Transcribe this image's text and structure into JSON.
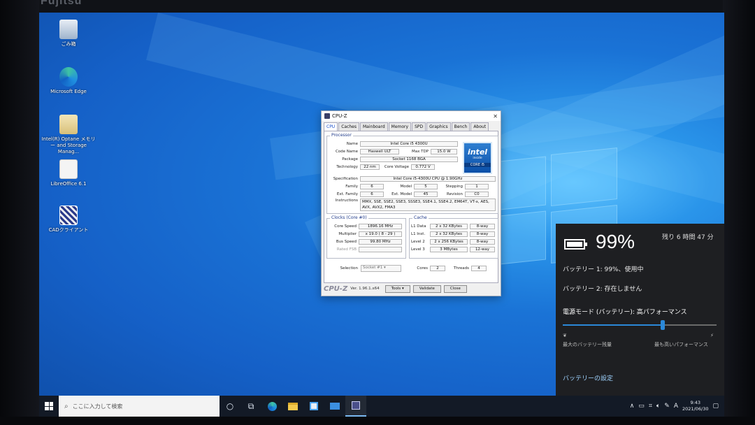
{
  "bezel": {
    "brand": "Fujitsu"
  },
  "desktop": {
    "icons": [
      {
        "label": "ごみ箱",
        "icon": "recycle-bin-icon"
      },
      {
        "label": "Microsoft Edge",
        "icon": "edge-icon"
      },
      {
        "label": "Intel(R) Optane メモリー and Storage Manag...",
        "icon": "folder-icon"
      },
      {
        "label": "LibreOffice 6.1",
        "icon": "document-icon"
      },
      {
        "label": "CADクライアント",
        "icon": "app-icon"
      }
    ]
  },
  "cpuz": {
    "title": "CPU-Z",
    "tabs": [
      "CPU",
      "Caches",
      "Mainboard",
      "Memory",
      "SPD",
      "Graphics",
      "Bench",
      "About"
    ],
    "processor": {
      "group_title": "Processor",
      "name_label": "Name",
      "name": "Intel Core i5 4300U",
      "codename_label": "Code Name",
      "codename": "Haswell ULT",
      "maxtdp_label": "Max TDP",
      "maxtdp": "15.0 W",
      "package_label": "Package",
      "package": "Socket 1168 BGA",
      "technology_label": "Technology",
      "technology": "22 nm",
      "voltage_label": "Core Voltage",
      "voltage": "0.772 V",
      "spec_label": "Specification",
      "spec": "Intel Core i5-4300U CPU @ 1.90GHz",
      "family_label": "Family",
      "family": "6",
      "model_label": "Model",
      "model": "5",
      "stepping_label": "Stepping",
      "stepping": "1",
      "extfamily_label": "Ext. Family",
      "extfamily": "6",
      "extmodel_label": "Ext. Model",
      "extmodel": "45",
      "revision_label": "Revision",
      "revision": "C0",
      "instructions_label": "Instructions",
      "instructions": "MMX, SSE, SSE2, SSE3, SSSE3, SSE4.1, SSE4.2, EM64T, VT-x, AES, AVX, AVX2, FMA3"
    },
    "intel_badge": {
      "brand": "intel",
      "inside": "inside",
      "line": "CORE i5"
    },
    "clocks": {
      "group_title": "Clocks (Core #0)",
      "corespeed_label": "Core Speed",
      "corespeed": "1896.16 MHz",
      "multiplier_label": "Multiplier",
      "multiplier": "x 19.0 ( 8 - 29 )",
      "busspeed_label": "Bus Speed",
      "busspeed": "99.80 MHz",
      "ratedfsb_label": "Rated FSB",
      "ratedfsb": ""
    },
    "cache": {
      "group_title": "Cache",
      "rows": [
        {
          "label": "L1 Data",
          "size": "2 x 32 KBytes",
          "way": "8-way"
        },
        {
          "label": "L1 Inst.",
          "size": "2 x 32 KBytes",
          "way": "8-way"
        },
        {
          "label": "Level 2",
          "size": "2 x 256 KBytes",
          "way": "8-way"
        },
        {
          "label": "Level 3",
          "size": "3 MBytes",
          "way": "12-way"
        }
      ]
    },
    "selection_label": "Selection",
    "selection": "Socket #1",
    "cores_label": "Cores",
    "cores": "2",
    "threads_label": "Threads",
    "threads": "4",
    "footer": {
      "brand": "CPU-Z",
      "version": "Ver. 1.96.1.x64",
      "tools": "Tools",
      "validate": "Validate",
      "close": "Close"
    }
  },
  "battery_flyout": {
    "percent": "99%",
    "percent_value": 99,
    "remaining": "残り 6 時間 47 分",
    "battery1": "バッテリー 1: 99%、使用中",
    "battery2": "バッテリー 2: 存在しません",
    "power_mode": "電源モード (バッテリー): 高パフォーマンス",
    "slider_value": 0.65,
    "left_caption": "最大のバッテリー残量",
    "right_caption": "最も高いパフォーマンス",
    "settings_link": "バッテリーの設定"
  },
  "taskbar": {
    "search_placeholder": "ここに入力して検索",
    "apps": [
      "cortana-icon",
      "task-view-icon",
      "edge-icon",
      "file-explorer-icon",
      "store-icon",
      "mail-icon",
      "cpuz-icon"
    ],
    "ime": "A",
    "time": "9:43",
    "date": "2021/06/30"
  }
}
